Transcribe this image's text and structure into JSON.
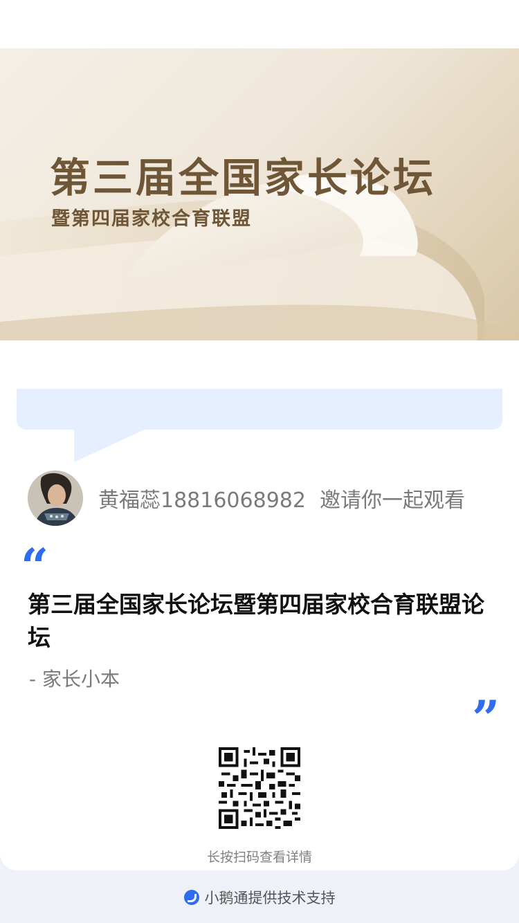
{
  "banner": {
    "title": "第三届全国家长论坛",
    "subtitle": "暨第四届家校合育联盟"
  },
  "invite": {
    "name": "黄福蕊18816068982",
    "text": "邀请你一起观看"
  },
  "quote": {
    "open_mark": "“",
    "close_mark": "”",
    "title": "第三届全国家长论坛暨第四届家校合育联盟论坛",
    "author": "- 家长小本"
  },
  "qr": {
    "hint": "长按扫码查看详情"
  },
  "footer": {
    "text": "小鹅通提供技术支持",
    "icon": "xiaoetong-logo-icon"
  },
  "colors": {
    "accent": "#2f6cf0",
    "bubble": "#e6efff",
    "page_bg": "#eef1f7",
    "banner_text": "#6f5637"
  }
}
